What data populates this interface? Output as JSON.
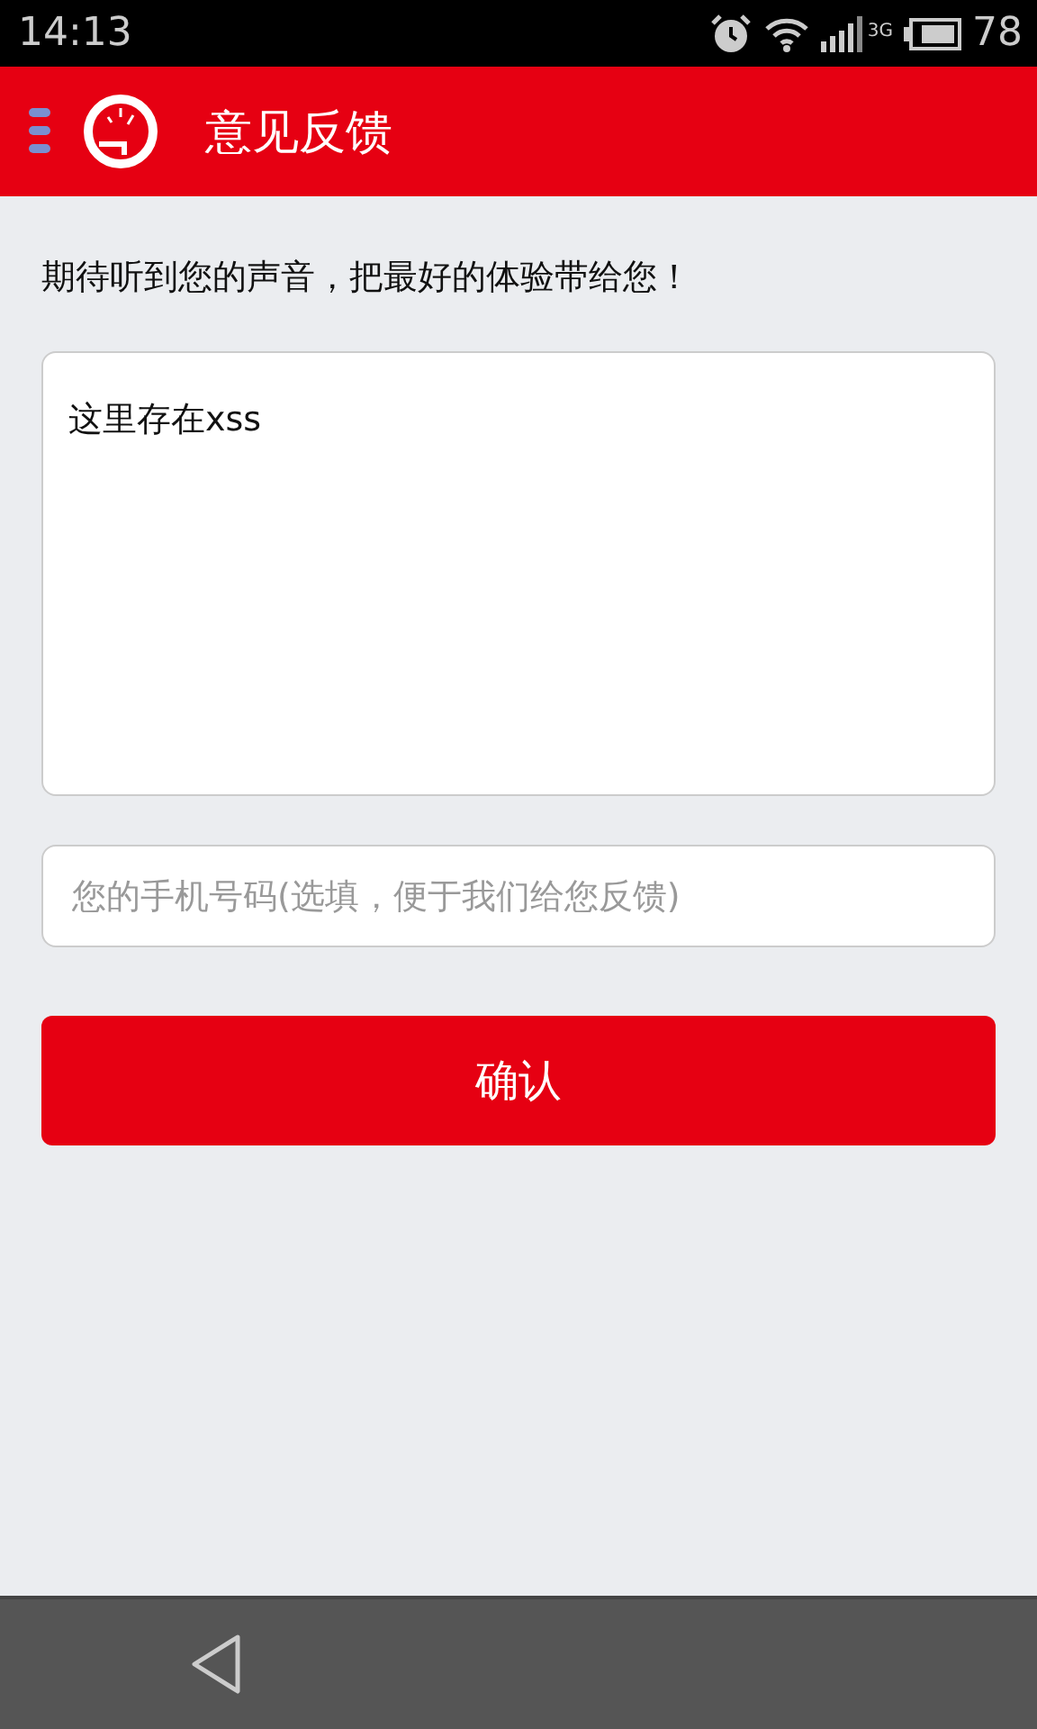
{
  "status_bar": {
    "time": "14:13",
    "network": "3G",
    "battery": "78"
  },
  "header": {
    "title": "意见反馈"
  },
  "intro": "期待听到您的声音，把最好的体验带给您！",
  "feedback": {
    "value": "这里存在xss"
  },
  "phone": {
    "placeholder": "您的手机号码(选填，便于我们给您反馈)"
  },
  "submit": {
    "label": "确认"
  }
}
